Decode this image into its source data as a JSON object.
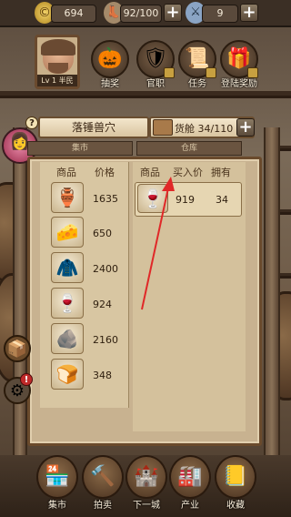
{
  "topbar": {
    "gold_value": "694",
    "stamina_value": "92/100",
    "weapon_value": "9",
    "plus_label": "+"
  },
  "player": {
    "level_label": "Lv 1 半民"
  },
  "header_icons": [
    {
      "label": "抽奖",
      "icon": "pumpkin-icon"
    },
    {
      "label": "官职",
      "icon": "crest-icon"
    },
    {
      "label": "任务",
      "icon": "scroll-icon"
    },
    {
      "label": "登陆奖励",
      "icon": "gift-icon"
    }
  ],
  "location": {
    "title": "落锤兽穴"
  },
  "cargo": {
    "label": "货舱 34/110"
  },
  "tabs": {
    "market": "集市",
    "warehouse": "仓库"
  },
  "market_table": {
    "headers": [
      "商品",
      "价格"
    ],
    "rows": [
      {
        "icon": "grail-icon",
        "price": "1635"
      },
      {
        "icon": "cheese-icon",
        "price": "650"
      },
      {
        "icon": "cloth-icon",
        "price": "2400"
      },
      {
        "icon": "wine-icon",
        "price": "924"
      },
      {
        "icon": "stone-icon",
        "price": "2160"
      },
      {
        "icon": "bread-icon",
        "price": "348"
      }
    ]
  },
  "warehouse_table": {
    "headers": [
      "商品",
      "买入价",
      "拥有"
    ],
    "rows": [
      {
        "icon": "wine-icon",
        "buy_price": "919",
        "owned": "34"
      }
    ]
  },
  "side": {
    "help_badge": "?",
    "alert_badge": "!"
  },
  "bottom_nav": [
    {
      "label": "集市",
      "icon": "market-icon"
    },
    {
      "label": "拍卖",
      "icon": "auction-icon"
    },
    {
      "label": "下一城",
      "icon": "castle-icon"
    },
    {
      "label": "产业",
      "icon": "industry-icon"
    },
    {
      "label": "收藏",
      "icon": "book-icon"
    }
  ],
  "colors": {
    "arrow": "#e02828",
    "panel_bg": "#c8b290",
    "topbar_bg": "#3b2f25"
  }
}
